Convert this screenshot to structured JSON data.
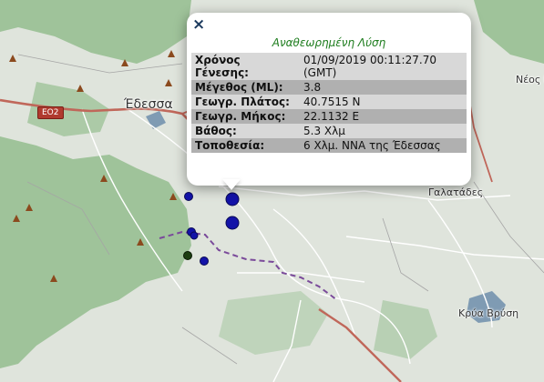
{
  "map": {
    "places": {
      "edessa": "Έδεσσα",
      "galatades": "Γαλατάδες",
      "krya_vrysi": "Κρύα Βρύση",
      "neos": "Νέος Μ"
    },
    "road_shield": "ΕΟ2",
    "colors": {
      "forest": "#9fc39a",
      "land": "#dfe4dc",
      "lake": "#7f9bb3",
      "road_major": "#c0675a",
      "boundary": "#7a4a9a",
      "quake": "#1313a8",
      "latest_quake": "#1b3d10"
    },
    "earthquake_markers": 7,
    "icons": [
      "close-icon",
      "peak-icon"
    ]
  },
  "popup": {
    "close_label": "×",
    "title": "Αναθεωρημένη Λύση",
    "rows": [
      {
        "key": "Χρόνος Γένεσης:",
        "value": "01/09/2019 00:11:27.70 (GMT)"
      },
      {
        "key": "Μέγεθος (ML):",
        "value": "3.8"
      },
      {
        "key": "Γεωγρ. Πλάτος:",
        "value": "40.7515 N"
      },
      {
        "key": "Γεωγρ. Μήκος:",
        "value": "22.1132 E"
      },
      {
        "key": "Βάθος:",
        "value": "5.3 Χλμ"
      },
      {
        "key": "Τοποθεσία:",
        "value": "6 Χλμ. ΝΝΑ της Έδεσσας"
      }
    ]
  }
}
